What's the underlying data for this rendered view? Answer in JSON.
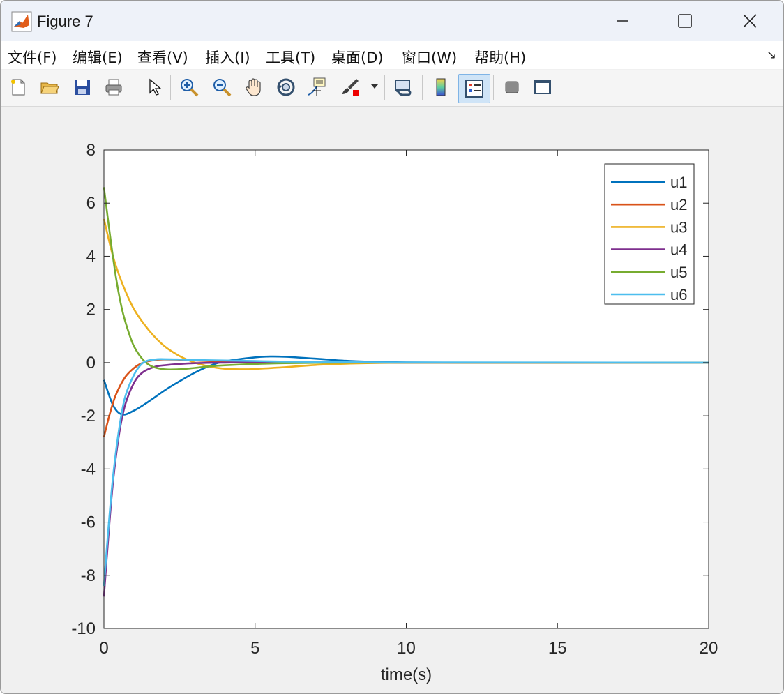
{
  "window": {
    "title": "Figure 7",
    "controls": {
      "minimize": "minimize",
      "maximize": "maximize",
      "close": "close"
    }
  },
  "menu": {
    "items": [
      {
        "label": "文件(F)"
      },
      {
        "label": "编辑(E)"
      },
      {
        "label": "查看(V)"
      },
      {
        "label": "插入(I)"
      },
      {
        "label": "工具(T)"
      },
      {
        "label": "桌面(D)"
      },
      {
        "label": "窗口(W)"
      },
      {
        "label": "帮助(H)"
      }
    ],
    "overflow_icon": "undock-arrow-icon"
  },
  "toolbar": {
    "icons": [
      "new-figure-icon",
      "open-folder-icon",
      "save-icon",
      "print-icon",
      "pointer-icon",
      "zoom-in-icon",
      "zoom-out-icon",
      "pan-hand-icon",
      "rotate-3d-icon",
      "data-cursor-icon",
      "brush-icon",
      "brush-dropdown-icon",
      "link-plot-icon",
      "colorbar-icon",
      "legend-icon",
      "hide-plot-tools-icon",
      "show-plot-tools-icon"
    ]
  },
  "colors": {
    "u1": "#0072BD",
    "u2": "#D95319",
    "u3": "#EDB120",
    "u4": "#7E2F8E",
    "u5": "#77AC30",
    "u6": "#4DBEEE"
  },
  "chart_data": {
    "type": "line",
    "title": "",
    "xlabel": "time(s)",
    "ylabel": "",
    "xlim": [
      0,
      20
    ],
    "ylim": [
      -10,
      8
    ],
    "xticks": [
      "0",
      "5",
      "10",
      "15",
      "20"
    ],
    "yticks": [
      "8",
      "6",
      "4",
      "2",
      "0",
      "-2",
      "-4",
      "-6",
      "-8",
      "-10"
    ],
    "grid": false,
    "legend_position": "top-right",
    "series": [
      {
        "name": "u1",
        "x": [
          0,
          0.3,
          0.6,
          1,
          1.5,
          2,
          2.5,
          3,
          3.5,
          4,
          5,
          5.5,
          6,
          7,
          8,
          9,
          10,
          12,
          15,
          20
        ],
        "y": [
          -0.65,
          -1.6,
          -1.95,
          -1.8,
          -1.45,
          -1.05,
          -0.7,
          -0.38,
          -0.12,
          0.05,
          0.2,
          0.23,
          0.22,
          0.15,
          0.07,
          0.03,
          0.01,
          0,
          0,
          0
        ]
      },
      {
        "name": "u2",
        "x": [
          0,
          0.2,
          0.4,
          0.7,
          1,
          1.3,
          1.7,
          2,
          2.5,
          3,
          4,
          5,
          6,
          8,
          10,
          20
        ],
        "y": [
          -2.8,
          -1.9,
          -1.2,
          -0.55,
          -0.2,
          0.0,
          0.1,
          0.12,
          0.11,
          0.08,
          0.04,
          0.02,
          0.01,
          0,
          0,
          0
        ]
      },
      {
        "name": "u3",
        "x": [
          0,
          0.3,
          0.6,
          1,
          1.5,
          2,
          2.5,
          3,
          3.5,
          4,
          4.5,
          5,
          6,
          7,
          8,
          10,
          12,
          20
        ],
        "y": [
          5.4,
          4.0,
          3.0,
          2.0,
          1.2,
          0.62,
          0.25,
          0.0,
          -0.15,
          -0.23,
          -0.25,
          -0.24,
          -0.17,
          -0.09,
          -0.04,
          0,
          0,
          0
        ]
      },
      {
        "name": "u4",
        "x": [
          0,
          0.15,
          0.3,
          0.5,
          0.7,
          1,
          1.3,
          1.7,
          2,
          2.5,
          3,
          4,
          5,
          6,
          8,
          10,
          20
        ],
        "y": [
          -8.8,
          -6.5,
          -4.5,
          -2.7,
          -1.6,
          -0.75,
          -0.35,
          -0.15,
          -0.1,
          -0.05,
          -0.02,
          0.0,
          0.02,
          0.02,
          0.01,
          0,
          0
        ]
      },
      {
        "name": "u5",
        "x": [
          0,
          0.2,
          0.4,
          0.6,
          0.8,
          1,
          1.3,
          1.6,
          2,
          2.5,
          3,
          3.5,
          4,
          5,
          6,
          8,
          10,
          20
        ],
        "y": [
          6.6,
          4.8,
          3.2,
          2.0,
          1.2,
          0.6,
          0.1,
          -0.15,
          -0.25,
          -0.25,
          -0.2,
          -0.14,
          -0.1,
          -0.05,
          -0.02,
          0,
          0,
          0
        ]
      },
      {
        "name": "u6",
        "x": [
          0,
          0.15,
          0.3,
          0.5,
          0.7,
          1,
          1.3,
          1.7,
          2,
          2.5,
          3,
          4,
          5,
          6,
          8,
          10,
          20
        ],
        "y": [
          -8.4,
          -6.2,
          -4.3,
          -2.5,
          -1.3,
          -0.45,
          0.0,
          0.12,
          0.13,
          0.12,
          0.1,
          0.08,
          0.06,
          0.04,
          0.02,
          0.01,
          0
        ]
      }
    ]
  }
}
